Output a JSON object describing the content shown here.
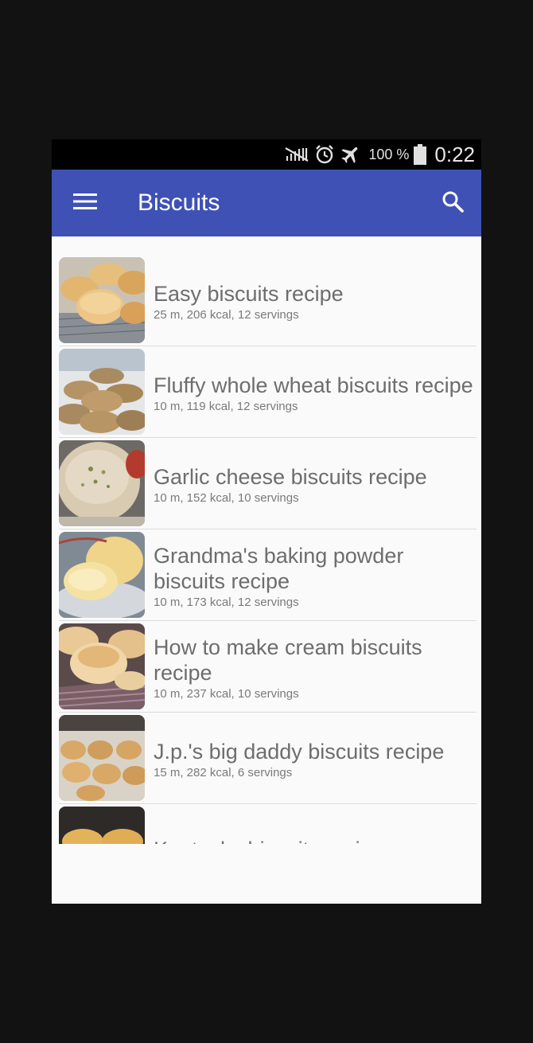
{
  "status_bar": {
    "battery_text": "100 %",
    "time": "0:22",
    "icons": [
      "no-signal-icon",
      "alarm-icon",
      "airplane-icon",
      "battery-icon"
    ]
  },
  "toolbar": {
    "title": "Biscuits",
    "menu_icon": "hamburger-menu-icon",
    "search_icon": "search-icon",
    "color": "#3f51b5"
  },
  "recipes": [
    {
      "title": "Easy biscuits recipe",
      "meta": "25 m, 206 kcal, 12 servings"
    },
    {
      "title": "Fluffy whole wheat biscuits recipe",
      "meta": "10 m, 119 kcal, 12 servings"
    },
    {
      "title": "Garlic cheese biscuits recipe",
      "meta": "10 m, 152 kcal, 10 servings"
    },
    {
      "title": "Grandma's baking powder biscuits recipe",
      "meta": "10 m, 173 kcal, 12 servings"
    },
    {
      "title": "How to make cream biscuits recipe",
      "meta": "10 m, 237 kcal, 10 servings"
    },
    {
      "title": "J.p.'s big daddy biscuits recipe",
      "meta": "15 m, 282 kcal, 6 servings"
    },
    {
      "title": "Kentucky biscuits recipe",
      "meta": ""
    }
  ]
}
